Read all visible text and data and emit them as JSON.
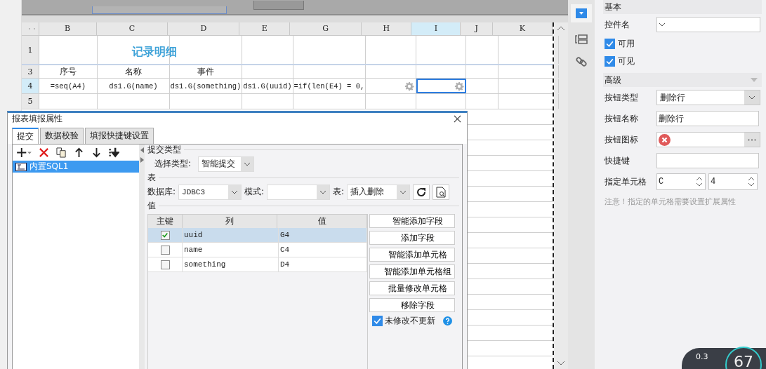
{
  "sheet": {
    "columns": [
      {
        "label": "B",
        "selected": false
      },
      {
        "label": "C",
        "selected": false
      },
      {
        "label": "D",
        "selected": false
      },
      {
        "label": "E",
        "selected": false
      },
      {
        "label": "G",
        "selected": false
      },
      {
        "label": "H",
        "selected": false
      },
      {
        "label": "I",
        "selected": true
      },
      {
        "label": "J",
        "selected": false
      },
      {
        "label": "K",
        "selected": false
      }
    ],
    "rows": [
      {
        "label": "1",
        "kind": "title",
        "selected": false,
        "cells": [
          {},
          {
            "text": "记录明细"
          },
          {},
          {},
          {},
          {},
          {},
          {},
          {}
        ]
      },
      {
        "label": "3",
        "kind": "header",
        "selected": false,
        "cells": [
          {
            "text": "序号"
          },
          {
            "text": "名称"
          },
          {
            "text": "事件"
          },
          {},
          {},
          {},
          {},
          {},
          {}
        ]
      },
      {
        "label": "4",
        "kind": "data",
        "selected": true,
        "cells": [
          {
            "text": "=seq(A4)"
          },
          {
            "text": "ds1.G(name)"
          },
          {
            "text": "ds1.G(something)"
          },
          {
            "text": "ds1.G(uuid)"
          },
          {
            "text": "=if(len(E4) = 0,"
          },
          {
            "button": true
          },
          {
            "button": true
          },
          {},
          {}
        ]
      },
      {
        "label": "5",
        "kind": "data",
        "selected": false,
        "cells": [
          {},
          {},
          {},
          {},
          {},
          {},
          {},
          {},
          {}
        ]
      }
    ]
  },
  "dialog": {
    "title": "报表填报属性",
    "tabs": [
      {
        "label": "提交",
        "selected": true
      },
      {
        "label": "数据校验",
        "selected": false
      },
      {
        "label": "填报快捷键设置",
        "selected": false
      }
    ],
    "submissions": [
      {
        "label": "内置SQL1",
        "selected": true
      }
    ],
    "submit_type": {
      "section": "提交类型",
      "label": "选择类型:",
      "value": "智能提交"
    },
    "table_section": "表",
    "database": {
      "label": "数据库:",
      "value": "JDBC3"
    },
    "schema": {
      "label": "模式:"
    },
    "table": {
      "label": "表:",
      "value": "插入删除"
    },
    "values_section": "值",
    "columns": [
      "主键",
      "列",
      "值"
    ],
    "rows": [
      {
        "key": true,
        "column": "uuid",
        "value": "G4",
        "selected": true
      },
      {
        "key": false,
        "column": "name",
        "value": "C4",
        "selected": false
      },
      {
        "key": false,
        "column": "something",
        "value": "D4",
        "selected": false
      }
    ],
    "buttons": [
      "智能添加字段",
      "添加字段",
      "智能添加单元格",
      "智能添加单元格组",
      "批量修改单元格",
      "移除字段"
    ],
    "skip_unchanged": {
      "label": "未修改不更新",
      "checked": true
    }
  },
  "panel": {
    "section_basic": "基本",
    "widget_name": {
      "label": "控件名"
    },
    "checks": [
      {
        "label": "可用",
        "checked": true
      },
      {
        "label": "可见",
        "checked": true
      }
    ],
    "section_advanced": "高级",
    "fields": [
      {
        "kind": "select",
        "label": "按钮类型",
        "value": "删除行"
      },
      {
        "kind": "text",
        "label": "按钮名称",
        "value": "删除行"
      },
      {
        "kind": "icon",
        "label": "按钮图标"
      },
      {
        "kind": "text",
        "label": "快捷键"
      },
      {
        "kind": "cell",
        "label": "指定单元格",
        "column": "C",
        "row": "4"
      }
    ],
    "note": "注意！指定的单元格需要设置扩展属性"
  },
  "net_widget": {
    "speed": "0.3",
    "score": "67"
  }
}
